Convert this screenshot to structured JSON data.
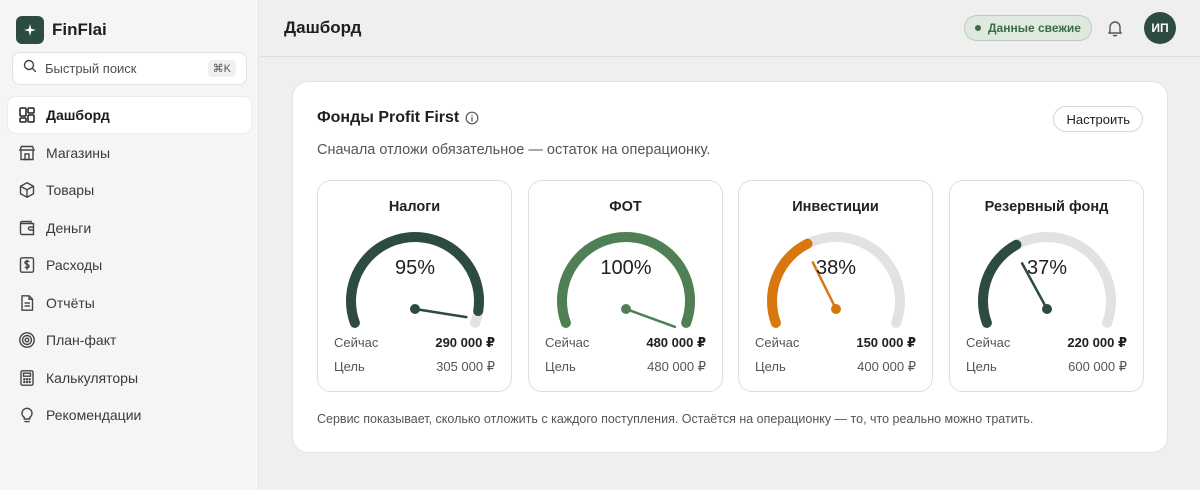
{
  "app": {
    "name": "FinFlai"
  },
  "search": {
    "placeholder": "Быстрый поиск",
    "shortcut": "⌘K"
  },
  "sidebar": {
    "items": [
      {
        "label": "Дашборд",
        "icon": "dashboard-icon",
        "active": true
      },
      {
        "label": "Магазины",
        "icon": "store-icon",
        "active": false
      },
      {
        "label": "Товары",
        "icon": "box-icon",
        "active": false
      },
      {
        "label": "Деньги",
        "icon": "wallet-icon",
        "active": false
      },
      {
        "label": "Расходы",
        "icon": "dollar-receipt-icon",
        "active": false
      },
      {
        "label": "Отчёты",
        "icon": "report-icon",
        "active": false
      },
      {
        "label": "План-факт",
        "icon": "target-icon",
        "active": false
      },
      {
        "label": "Калькуляторы",
        "icon": "calculator-icon",
        "active": false
      },
      {
        "label": "Рекомендации",
        "icon": "lightbulb-icon",
        "active": false
      }
    ]
  },
  "header": {
    "title": "Дашборд",
    "status": "Данные свежие",
    "avatar_initials": "ИП"
  },
  "card": {
    "title": "Фонды Profit First",
    "configure_label": "Настроить",
    "subtitle": "Сначала отложи обязательное — остаток на операционку.",
    "footnote": "Сервис показывает, сколько отложить с каждого поступления. Остаётся на операционку — то, что реально можно тратить.",
    "now_label": "Сейчас",
    "goal_label": "Цель"
  },
  "funds": [
    {
      "name": "Налоги",
      "percent_label": "95%",
      "percent": 95,
      "now": "290 000 ₽",
      "goal": "305 000 ₽",
      "color": "#2e4b3f"
    },
    {
      "name": "ФОТ",
      "percent_label": "100%",
      "percent": 100,
      "now": "480 000 ₽",
      "goal": "480 000 ₽",
      "color": "#4f7f55"
    },
    {
      "name": "Инвестиции",
      "percent_label": "38%",
      "percent": 38,
      "now": "150 000 ₽",
      "goal": "400 000 ₽",
      "color": "#d9770f"
    },
    {
      "name": "Резервный фонд",
      "percent_label": "37%",
      "percent": 37,
      "now": "220 000 ₽",
      "goal": "600 000 ₽",
      "color": "#2e4b3f"
    }
  ],
  "colors": {
    "brand": "#2e4b3f",
    "status_bg": "#dfe9df",
    "status_text": "#3d6b45",
    "gauge_track": "#e2e2e2"
  }
}
